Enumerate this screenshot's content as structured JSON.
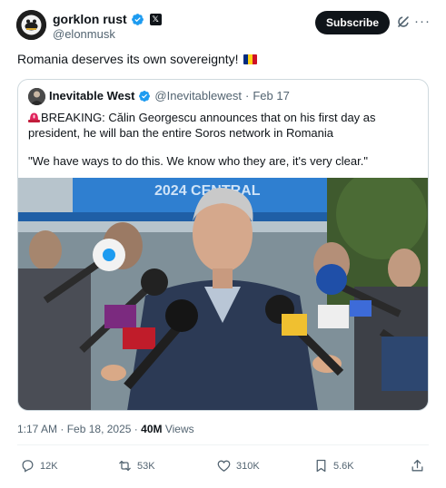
{
  "author": {
    "display_name": "gorklon rust",
    "handle": "@elonmusk",
    "affiliation_badge": "𝕏"
  },
  "header": {
    "subscribe_label": "Subscribe",
    "more_label": "···"
  },
  "post": {
    "text": "Romania deserves its own sovereignty!",
    "flag_colors": [
      "#002B7F",
      "#FCD116",
      "#CE1126"
    ]
  },
  "quoted_post": {
    "display_name": "Inevitable West",
    "handle": "@Inevitablewest",
    "separator": "·",
    "date": "Feb 17",
    "text": "BREAKING: Călin Georgescu announces that on his first day as president, he will ban the entire Soros network in Romania",
    "quote": "\"We have ways to do this. We know who they are, it's very clear.\"",
    "media_sign_text": "2024 CENTRAL"
  },
  "meta": {
    "time": "1:17 AM",
    "separator": "·",
    "date": "Feb 18, 2025",
    "views_count": "40M",
    "views_label": "Views"
  },
  "actions": {
    "replies": "12K",
    "reposts": "53K",
    "likes": "310K",
    "bookmarks": "5.6K"
  },
  "colors": {
    "verified_blue": "#1d9bf0",
    "text_primary": "#0f1419",
    "text_secondary": "#536471",
    "border": "#cfd9de",
    "siren_red": "#e0245e"
  },
  "icons": {
    "reply": "reply-icon",
    "repost": "repost-icon",
    "like": "heart-icon",
    "bookmark": "bookmark-icon",
    "share": "share-icon",
    "grok": "grok-icon",
    "more": "more-icon"
  }
}
